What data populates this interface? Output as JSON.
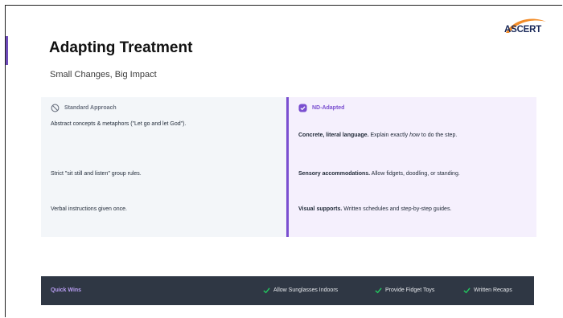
{
  "slide": {
    "title": "Adapting Treatment",
    "subtitle": "Small Changes, Big Impact",
    "logo_text": "ASCERT"
  },
  "standard": {
    "header": "Standard Approach",
    "header_icon": "prohibited-icon",
    "rows": [
      "Abstract concepts & metaphors (\"Let go and let God\").",
      "Strict \"sit still and listen\" group rules.",
      "Verbal instructions given once."
    ]
  },
  "adapted": {
    "header": "ND-Adapted",
    "header_icon": "check-badge-icon",
    "rows": [
      {
        "bold": "Concrete, literal language.",
        "text_pre": " Explain exactly ",
        "italic": "how",
        "text_post": " to do the step."
      },
      {
        "bold": "Sensory accommodations.",
        "text_pre": " Allow fidgets, doodling, or standing.",
        "italic": "",
        "text_post": ""
      },
      {
        "bold": "Visual supports.",
        "text_pre": " Written schedules and step-by-step guides.",
        "italic": "",
        "text_post": ""
      }
    ]
  },
  "quick_wins": {
    "label": "Quick Wins",
    "items": [
      "Allow Sunglasses Indoors",
      "Provide Fidget Toys",
      "Written Recaps"
    ]
  },
  "colors": {
    "accent": "#7a4fd0",
    "footer_bg": "#2f3744",
    "check_green": "#22c55e",
    "logo_orange": "#f28c28"
  }
}
